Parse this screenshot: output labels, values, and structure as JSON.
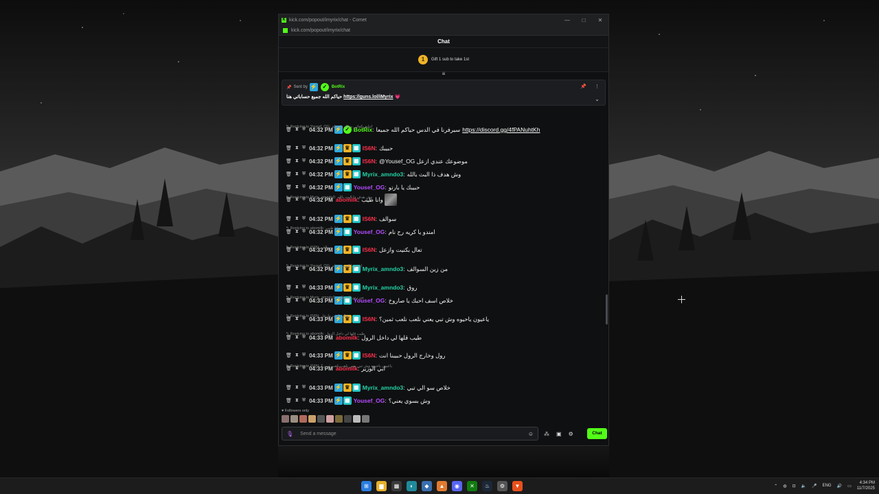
{
  "window": {
    "title": "kick.com/popout/imyrix/chat - Comet",
    "url": "kick.com/popout/imyrix/chat",
    "controls": [
      "—",
      "□",
      "✕"
    ]
  },
  "chat": {
    "header": "Chat",
    "goal_number": "1",
    "goal_text": "Gift 1 sub to take 1st",
    "pinned": {
      "sent_by_label": "Sent by",
      "sender": "BotRix",
      "message_prefix": "حياكم الله جميع حساباتي هنا",
      "link": "https://guns.lol/iMyrix",
      "heart": "💗"
    }
  },
  "messages": [
    {
      "time": "04:32 PM",
      "user": "BotRix",
      "color": "#53fc18",
      "badges": [
        "blue",
        "green"
      ],
      "text": "سيرفرنا في الدس حياكم الله جميعا",
      "link": "https://discord.gg/4fPANuhtKh"
    },
    {
      "reply": "Replying to Yousef_OG:",
      "reply_text": "اتنابع بكفاتي بنعاله واسطة"
    },
    {
      "time": "04:32 PM",
      "user": "IS6N",
      "color": "#ff2e4c",
      "badges": [
        "blue",
        "gold",
        "teal"
      ],
      "text": "حبيبك"
    },
    {
      "time": "04:32 PM",
      "user": "IS6N",
      "color": "#ff2e4c",
      "badges": [
        "blue",
        "gold",
        "teal"
      ],
      "text": "@Yousef_OG موضوعك عندي ازعل"
    },
    {
      "time": "04:32 PM",
      "user": "Myrix_amndo3",
      "color": "#22d3a6",
      "badges": [
        "blue",
        "gold",
        "teal"
      ],
      "text": "وش هدف ذا البث بالله"
    },
    {
      "time": "04:32 PM",
      "user": "Yousef_OG",
      "color": "#b44cff",
      "badges": [
        "blue",
        "teal"
      ],
      "text": "حبيبك يا بارتو"
    },
    {
      "time": "04:32 PM",
      "user": "abomilk",
      "color": "#ff2e4c",
      "badges": [],
      "text": "وانا طيب",
      "emote": true
    },
    {
      "reply": "Replying to Myrix_amndo3:",
      "reply_text": "وش هدف ذا البث بالله"
    },
    {
      "time": "04:32 PM",
      "user": "IS6N",
      "color": "#ff2e4c",
      "badges": [
        "blue",
        "gold",
        "teal"
      ],
      "text": "سوالف"
    },
    {
      "time": "04:32 PM",
      "user": "Yousef_OG",
      "color": "#b44cff",
      "badges": [
        "blue",
        "teal"
      ],
      "text": "امندو يا كريه رح نام"
    },
    {
      "reply": "Replying to abomilk:",
      "reply_text": "وانا طيب"
    },
    {
      "time": "04:32 PM",
      "user": "IS6N",
      "color": "#ff2e4c",
      "badges": [
        "blue",
        "gold",
        "teal"
      ],
      "text": "تعال بكنيت وازعل"
    },
    {
      "reply": "Replying to IS6N:",
      "reply_text": "سوالف"
    },
    {
      "time": "04:32 PM",
      "user": "Myrix_amndo3",
      "color": "#22d3a6",
      "badges": [
        "blue",
        "gold",
        "teal"
      ],
      "text": "من زين السوالف"
    },
    {
      "reply": "Replying to Yousef_OG:",
      "reply_text": "امندو يا كريه رح نام"
    },
    {
      "time": "04:33 PM",
      "user": "Myrix_amndo3",
      "color": "#22d3a6",
      "badges": [
        "blue",
        "gold",
        "teal"
      ],
      "text": "روق"
    },
    {
      "time": "04:33 PM",
      "user": "Yousef_OG",
      "color": "#b44cff",
      "badges": [
        "blue",
        "teal"
      ],
      "text": "خلاص اسف احبك يا صاروخ"
    },
    {
      "reply": "Replying to Myrix_amndo3:",
      "reply_text": "من زين السوالف"
    },
    {
      "time": "04:33 PM",
      "user": "IS6N",
      "color": "#ff2e4c",
      "badges": [
        "blue",
        "gold",
        "teal"
      ],
      "text": "ياعيون ياحيوه وش تبي يعني نلعب نلعب ثمين؟"
    },
    {
      "reply": "Replying to IS6N:",
      "reply_text": "تعال بكنيت وازعل"
    },
    {
      "time": "04:33 PM",
      "user": "abomilk",
      "color": "#ff2e4c",
      "badges": [],
      "text": "طيب قلها لي داخل الرول"
    },
    {
      "reply": "Replying to abomilk:",
      "reply_text": "طيب قلها لي داخل الرول"
    },
    {
      "time": "04:33 PM",
      "user": "IS6N",
      "color": "#ff2e4c",
      "badges": [
        "blue",
        "gold",
        "teal"
      ],
      "text": "رول وخارج الرول حبيبنا انت"
    },
    {
      "time": "04:33 PM",
      "user": "abomilk",
      "color": "#ff2e4c",
      "badges": [],
      "text": "ابي الوزير"
    },
    {
      "reply": "Replying to IS6N:",
      "reply_text": "ياعيون ياحيوه وش تبي يعني نلعب نلعب ثمين؟"
    },
    {
      "time": "04:33 PM",
      "user": "Myrix_amndo3",
      "color": "#22d3a6",
      "badges": [
        "blue",
        "gold",
        "teal"
      ],
      "text": "خلاص سو الي تبي"
    },
    {
      "time": "04:33 PM",
      "user": "Yousef_OG",
      "color": "#b44cff",
      "badges": [
        "blue",
        "teal"
      ],
      "text": "وش بسوي يعني؟"
    },
    {
      "time": "04:33 PM",
      "user": "abomilk",
      "color": "#ff2e4c",
      "badges": [],
      "text": "",
      "emote": true
    }
  ],
  "footer": {
    "followers_only": "Followers only",
    "input_placeholder": "Send a message",
    "send_button": "Chat"
  },
  "taskbar": {
    "language": "ENG",
    "time": "4:34 PM",
    "date": "11/7/2025"
  },
  "colors": {
    "kick_green": "#53fc18",
    "panel_bg": "#0f1011"
  }
}
